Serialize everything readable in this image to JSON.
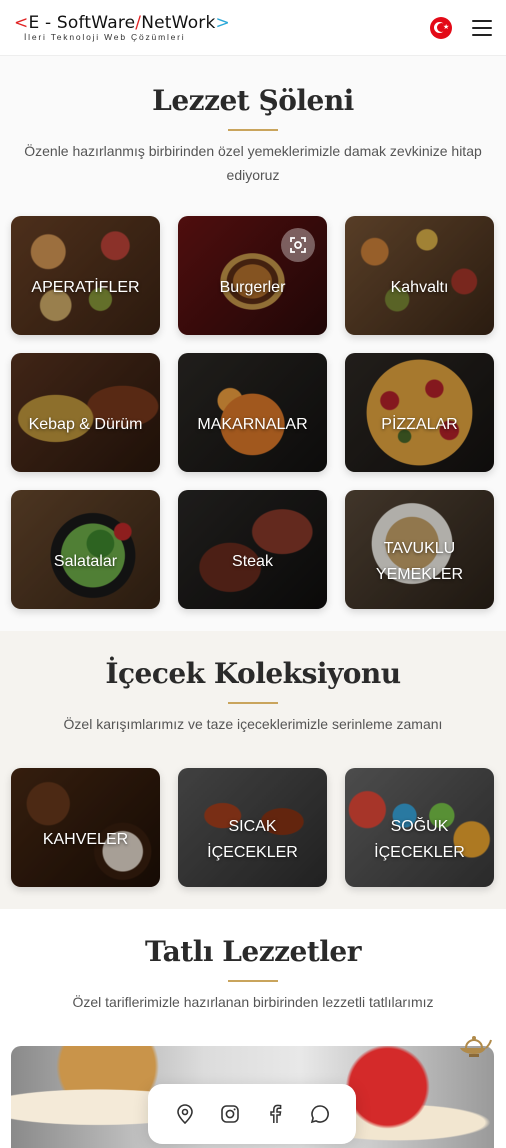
{
  "header": {
    "logo_lt": "<",
    "logo_left": "E - SoftWare",
    "logo_slash": "/",
    "logo_right": "NetWork",
    "logo_gt": ">",
    "logo_tagline": "İleri Teknoloji Web Çözümleri"
  },
  "food_section": {
    "title": "Lezzet Şöleni",
    "subtitle": "Özenle hazırlanmış birbirinden özel yemeklerimizle damak zevkinize hitap ediyoruz",
    "categories": [
      {
        "label": "APERATİFLER"
      },
      {
        "label": "Burgerler"
      },
      {
        "label": "Kahvaltı"
      },
      {
        "label": "Kebap & Dürüm"
      },
      {
        "label": "MAKARNALAR"
      },
      {
        "label": "PİZZALAR"
      },
      {
        "label": "Salatalar"
      },
      {
        "label": "Steak"
      },
      {
        "label": "TAVUKLU YEMEKLER"
      }
    ]
  },
  "drinks_section": {
    "title": "İçecek Koleksiyonu",
    "subtitle": "Özel karışımlarımız ve taze içeceklerimizle serinleme zamanı",
    "categories": [
      {
        "label": "KAHVELER"
      },
      {
        "label": "SICAK İÇECEKLER"
      },
      {
        "label": "SOĞUK İÇECEKLER"
      }
    ]
  },
  "desserts_section": {
    "title": "Tatlı Lezzetler",
    "subtitle": "Özel tariflerimizle hazırlanan birbirinden lezzetli tatlılarımız"
  },
  "icons": {
    "flag": "turkey-flag-icon",
    "menu": "hamburger-menu-icon",
    "scan": "visual-search-icon",
    "lamp": "magic-lamp-icon",
    "social": [
      "location-pin-icon",
      "instagram-icon",
      "facebook-icon",
      "whatsapp-icon"
    ]
  },
  "colors": {
    "accent_gold": "#c9a45c",
    "logo_red": "#e02424",
    "logo_blue": "#2aa8d8",
    "flag_red": "#e30a17"
  }
}
